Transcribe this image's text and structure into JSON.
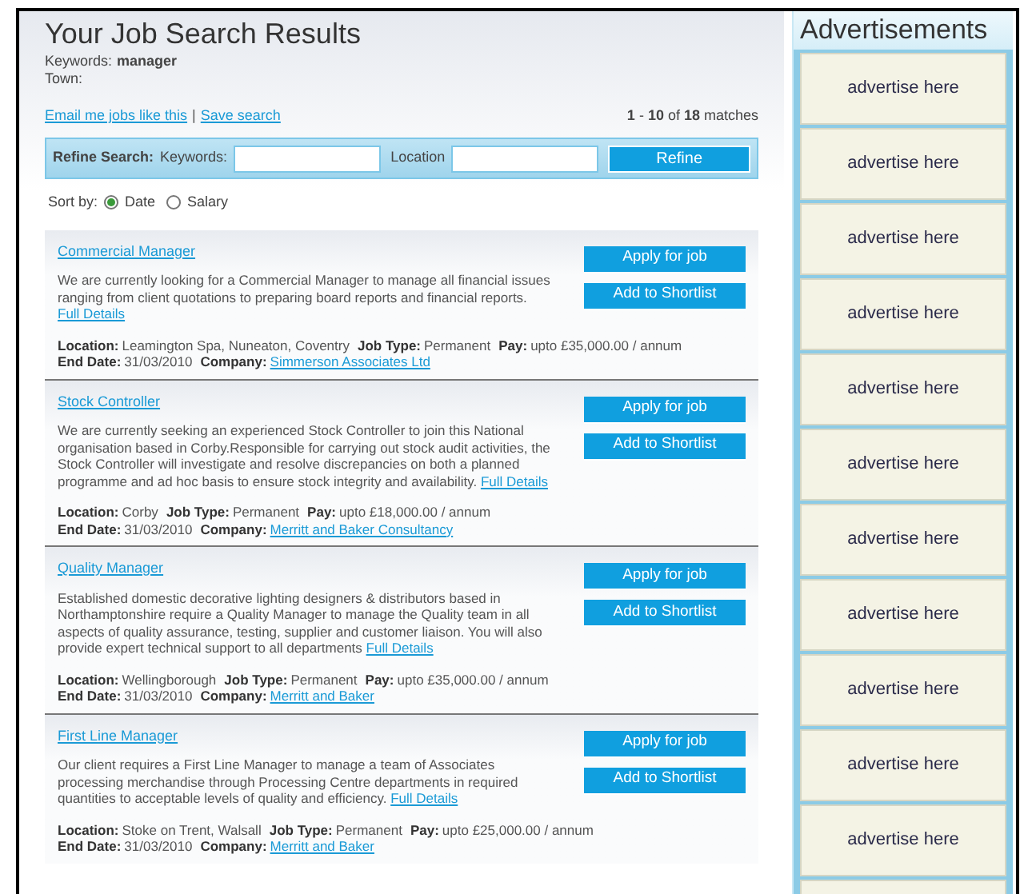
{
  "header": {
    "title": "Your Job Search Results",
    "criteria": [
      {
        "label": "Keywords:",
        "value": "manager"
      },
      {
        "label": "Town:"
      }
    ]
  },
  "links": [
    {
      "text": "Email me jobs like this"
    },
    {
      "text": "Save search"
    }
  ],
  "link_separator": "|",
  "match_count": "**1** - **10** of **18** matches",
  "refine": {
    "title": "Refine Search:",
    "keywords_label": "Keywords:",
    "location_label": "Location",
    "button": "Refine"
  },
  "sort": {
    "label": "Sort by:",
    "options": [
      {
        "label": "Date",
        "selected": true
      },
      {
        "label": "Salary",
        "selected": false
      }
    ]
  },
  "jobs": [
    {
      "title": "Commercial Manager",
      "description": "We are currently looking for a Commercial Manager to manage all financial issues ranging from client quotations to preparing board reports and financial reports.",
      "details_link": "Full Details",
      "line_1": [
        {
          "label": "Location:",
          "value": "Leamington Spa, Nuneaton, Coventry",
          "kind": "text"
        },
        {
          "label": "Job Type:",
          "value": "Permanent",
          "kind": "text"
        },
        {
          "label": "Pay:",
          "value": "upto £35,000.00 / annum",
          "kind": "text"
        }
      ],
      "line_2": [
        {
          "label": "End Date:",
          "value": "31/03/2010",
          "kind": "text"
        },
        {
          "label": "Company:",
          "value": "Simmerson Associates Ltd",
          "kind": "link"
        }
      ],
      "apply": "Apply for job",
      "shortlist": "Add to Shortlist"
    },
    {
      "title": "Stock Controller",
      "description": "We are currently seeking an experienced Stock Controller to join this National organisation based in Corby.Responsible for carrying out stock audit activities, the Stock Controller will investigate and resolve discrepancies on both a planned programme and ad hoc basis to ensure stock integrity and availability.",
      "details_link": "Full Details",
      "line_1": [
        {
          "label": "Location:",
          "value": "Corby",
          "kind": "text"
        },
        {
          "label": "Job Type:",
          "value": "Permanent",
          "kind": "text"
        },
        {
          "label": "Pay:",
          "value": "upto £18,000.00 / annum",
          "kind": "text"
        }
      ],
      "line_2": [
        {
          "label": "End Date:",
          "value": "31/03/2010",
          "kind": "text"
        },
        {
          "label": "Company:",
          "value": "Merritt and Baker Consultancy",
          "kind": "link"
        }
      ],
      "apply": "Apply for job",
      "shortlist": "Add to Shortlist"
    },
    {
      "title": "Quality Manager",
      "description": "Established domestic decorative lighting designers & distributors based in Northamptonshire require a Quality Manager to manage the Quality team in all aspects of quality assurance, testing, supplier and customer liaison. You will also provide expert technical support to all departments",
      "details_link": "Full Details",
      "line_1": [
        {
          "label": "Location:",
          "value": "Wellingborough",
          "kind": "text"
        },
        {
          "label": "Job Type:",
          "value": "Permanent",
          "kind": "text"
        },
        {
          "label": "Pay:",
          "value": "upto £35,000.00 / annum",
          "kind": "text"
        }
      ],
      "line_2": [
        {
          "label": "End Date:",
          "value": "31/03/2010",
          "kind": "text"
        },
        {
          "label": "Company:",
          "value": "Merritt and Baker",
          "kind": "link"
        }
      ],
      "apply": "Apply for job",
      "shortlist": "Add to Shortlist"
    },
    {
      "title": "First Line Manager",
      "description": "Our client requires a First Line Manager to manage a team of Associates processing merchandise through Processing Centre departments in required quantities to acceptable levels of quality and efficiency.",
      "details_link": "Full Details",
      "line_1": [
        {
          "label": "Location:",
          "value": "Stoke on Trent, Walsall",
          "kind": "text"
        },
        {
          "label": "Job Type:",
          "value": "Permanent",
          "kind": "text"
        },
        {
          "label": "Pay:",
          "value": "upto £25,000.00 / annum",
          "kind": "text"
        }
      ],
      "line_2": [
        {
          "label": "End Date:",
          "value": "31/03/2010",
          "kind": "text"
        },
        {
          "label": "Company:",
          "value": "Merritt and Baker",
          "kind": "link"
        }
      ],
      "apply": "Apply for job",
      "shortlist": "Add to Shortlist"
    }
  ],
  "advertisements": {
    "title": "Advertisements",
    "items": [
      "advertise here",
      "advertise here",
      "advertise here",
      "advertise here",
      "advertise here",
      "advertise here",
      "advertise here",
      "advertise here",
      "advertise here",
      "advertise here",
      "advertise here"
    ]
  }
}
